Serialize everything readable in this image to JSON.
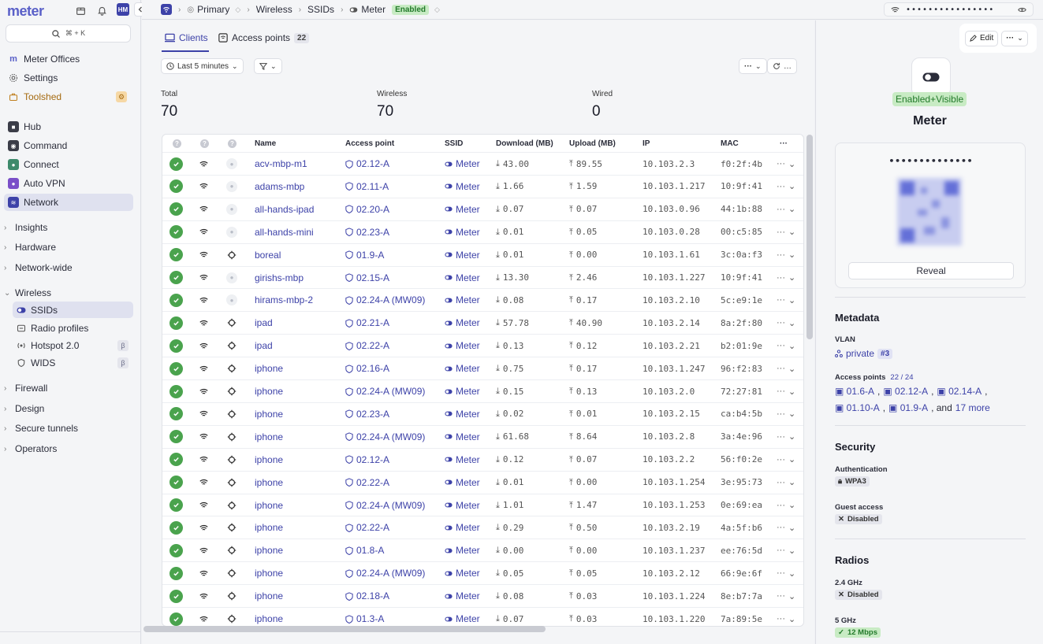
{
  "app": {
    "logo": "meter",
    "avatar": "HM",
    "search_kbd": "⌘ + K"
  },
  "sidebar": {
    "top_items": [
      {
        "label": "Meter Offices"
      },
      {
        "label": "Settings"
      },
      {
        "label": "Toolshed"
      }
    ],
    "products": [
      {
        "label": "Hub",
        "color": "#3b3d48"
      },
      {
        "label": "Command",
        "color": "#3b3d48"
      },
      {
        "label": "Connect",
        "color": "#3d8a6b"
      },
      {
        "label": "Auto VPN",
        "color": "#7a4fc8"
      },
      {
        "label": "Network",
        "color": "#3d42a8"
      }
    ],
    "groups_a": [
      "Insights",
      "Hardware",
      "Network-wide"
    ],
    "wireless_label": "Wireless",
    "wireless_items": [
      {
        "label": "SSIDs",
        "beta": ""
      },
      {
        "label": "Radio profiles",
        "beta": ""
      },
      {
        "label": "Hotspot 2.0",
        "beta": "β"
      },
      {
        "label": "WIDS",
        "beta": "β"
      }
    ],
    "groups_b": [
      "Firewall",
      "Design",
      "Secure tunnels",
      "Operators"
    ]
  },
  "topbar": {
    "crumbs": [
      "Primary",
      "Wireless",
      "SSIDs",
      "Meter"
    ],
    "status": "Enabled",
    "password_mask": "••••••••••••••••"
  },
  "main": {
    "tabs": [
      {
        "label": "Clients"
      },
      {
        "label": "Access points",
        "count": "22"
      }
    ],
    "time_filter": "Last 5 minutes",
    "stats": [
      {
        "label": "Total",
        "value": "70"
      },
      {
        "label": "Wireless",
        "value": "70"
      },
      {
        "label": "Wired",
        "value": "0"
      }
    ],
    "columns": [
      "Name",
      "Access point",
      "SSID",
      "Download (MB)",
      "Upload (MB)",
      "IP",
      "MAC"
    ],
    "rows": [
      {
        "name": "acv-mbp-m1",
        "ap": "02.12-A",
        "ssid": "Meter",
        "down": "43.00",
        "up": "89.55",
        "ip": "10.103.2.3",
        "mac": "f0:2f:4b",
        "apple": true
      },
      {
        "name": "adams-mbp",
        "ap": "02.11-A",
        "ssid": "Meter",
        "down": "1.66",
        "up": "1.59",
        "ip": "10.103.1.217",
        "mac": "10:9f:41",
        "apple": true
      },
      {
        "name": "all-hands-ipad",
        "ap": "02.20-A",
        "ssid": "Meter",
        "down": "0.07",
        "up": "0.07",
        "ip": "10.103.0.96",
        "mac": "44:1b:88",
        "apple": true
      },
      {
        "name": "all-hands-mini",
        "ap": "02.23-A",
        "ssid": "Meter",
        "down": "0.01",
        "up": "0.05",
        "ip": "10.103.0.28",
        "mac": "00:c5:85",
        "apple": true
      },
      {
        "name": "boreal",
        "ap": "01.9-A",
        "ssid": "Meter",
        "down": "0.01",
        "up": "0.00",
        "ip": "10.103.1.61",
        "mac": "3c:0a:f3",
        "apple": false
      },
      {
        "name": "girishs-mbp",
        "ap": "02.15-A",
        "ssid": "Meter",
        "down": "13.30",
        "up": "2.46",
        "ip": "10.103.1.227",
        "mac": "10:9f:41",
        "apple": true
      },
      {
        "name": "hirams-mbp-2",
        "ap": "02.24-A (MW09)",
        "ssid": "Meter",
        "down": "0.08",
        "up": "0.17",
        "ip": "10.103.2.10",
        "mac": "5c:e9:1e",
        "apple": true
      },
      {
        "name": "ipad",
        "ap": "02.21-A",
        "ssid": "Meter",
        "down": "57.78",
        "up": "40.90",
        "ip": "10.103.2.14",
        "mac": "8a:2f:80",
        "apple": false
      },
      {
        "name": "ipad",
        "ap": "02.22-A",
        "ssid": "Meter",
        "down": "0.13",
        "up": "0.12",
        "ip": "10.103.2.21",
        "mac": "b2:01:9e",
        "apple": false
      },
      {
        "name": "iphone",
        "ap": "02.16-A",
        "ssid": "Meter",
        "down": "0.75",
        "up": "0.17",
        "ip": "10.103.1.247",
        "mac": "96:f2:83",
        "apple": false
      },
      {
        "name": "iphone",
        "ap": "02.24-A (MW09)",
        "ssid": "Meter",
        "down": "0.15",
        "up": "0.13",
        "ip": "10.103.2.0",
        "mac": "72:27:81",
        "apple": false
      },
      {
        "name": "iphone",
        "ap": "02.23-A",
        "ssid": "Meter",
        "down": "0.02",
        "up": "0.01",
        "ip": "10.103.2.15",
        "mac": "ca:b4:5b",
        "apple": false
      },
      {
        "name": "iphone",
        "ap": "02.24-A (MW09)",
        "ssid": "Meter",
        "down": "61.68",
        "up": "8.64",
        "ip": "10.103.2.8",
        "mac": "3a:4e:96",
        "apple": false
      },
      {
        "name": "iphone",
        "ap": "02.12-A",
        "ssid": "Meter",
        "down": "0.12",
        "up": "0.07",
        "ip": "10.103.2.2",
        "mac": "56:f0:2e",
        "apple": false
      },
      {
        "name": "iphone",
        "ap": "02.22-A",
        "ssid": "Meter",
        "down": "0.01",
        "up": "0.00",
        "ip": "10.103.1.254",
        "mac": "3e:95:73",
        "apple": false
      },
      {
        "name": "iphone",
        "ap": "02.24-A (MW09)",
        "ssid": "Meter",
        "down": "1.01",
        "up": "1.47",
        "ip": "10.103.1.253",
        "mac": "0e:69:ea",
        "apple": false
      },
      {
        "name": "iphone",
        "ap": "02.22-A",
        "ssid": "Meter",
        "down": "0.29",
        "up": "0.50",
        "ip": "10.103.2.19",
        "mac": "4a:5f:b6",
        "apple": false
      },
      {
        "name": "iphone",
        "ap": "01.8-A",
        "ssid": "Meter",
        "down": "0.00",
        "up": "0.00",
        "ip": "10.103.1.237",
        "mac": "ee:76:5d",
        "apple": false
      },
      {
        "name": "iphone",
        "ap": "02.24-A (MW09)",
        "ssid": "Meter",
        "down": "0.05",
        "up": "0.05",
        "ip": "10.103.2.12",
        "mac": "66:9e:6f",
        "apple": false
      },
      {
        "name": "iphone",
        "ap": "02.18-A",
        "ssid": "Meter",
        "down": "0.08",
        "up": "0.03",
        "ip": "10.103.1.224",
        "mac": "8e:b7:7a",
        "apple": false
      },
      {
        "name": "iphone",
        "ap": "01.3-A",
        "ssid": "Meter",
        "down": "0.07",
        "up": "0.03",
        "ip": "10.103.1.220",
        "mac": "7a:89:5e",
        "apple": false
      }
    ]
  },
  "panel": {
    "edit_label": "Edit",
    "status_a": "Enabled",
    "status_sep": "+",
    "status_b": "Visible",
    "ssid_name": "Meter",
    "password_mask": "••••••••••••••",
    "reveal_label": "Reveal",
    "metadata_title": "Metadata",
    "vlan_label": "VLAN",
    "vlan_value": "private",
    "vlan_id": "#3",
    "ap_label": "Access points",
    "ap_count": "22 / 24",
    "ap_list_1": [
      "01.6-A",
      "02.12-A",
      "02.14-A"
    ],
    "ap_list_2": [
      "01.10-A",
      "01.9-A"
    ],
    "ap_and": ", and",
    "ap_more": "17 more",
    "security_title": "Security",
    "auth_label": "Authentication",
    "auth_value": "WPA3",
    "guest_label": "Guest access",
    "guest_value": "Disabled",
    "radios_title": "Radios",
    "r24_label": "2.4 GHz",
    "r24_value": "Disabled",
    "r5_label": "5 GHz",
    "r5_value": "12 Mbps"
  }
}
